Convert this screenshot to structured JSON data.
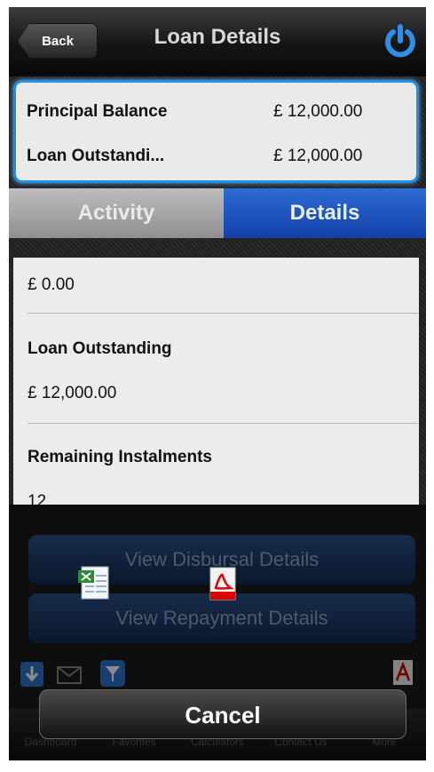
{
  "header": {
    "back_label": "Back",
    "title": "Loan Details",
    "power_icon": "power-icon"
  },
  "summary": {
    "principal_label": "Principal Balance",
    "principal_value": "£ 12,000.00",
    "outstanding_label": "Loan Outstandi...",
    "outstanding_value": "£ 12,000.00"
  },
  "tabs": {
    "activity": "Activity",
    "details": "Details",
    "selected": "Details"
  },
  "details": {
    "top_value": "£ 0.00",
    "loan_outstanding_label": "Loan Outstanding",
    "loan_outstanding_value": "£ 12,000.00",
    "remaining_label": "Remaining Instalments",
    "remaining_value": "12"
  },
  "actions": {
    "disbursal": "View Disbursal Details",
    "repayment": "View Repayment Details"
  },
  "tabbar": {
    "items": [
      {
        "label": "Dashboard",
        "icon": "dashboard-icon"
      },
      {
        "label": "Favorites",
        "icon": "star-icon"
      },
      {
        "label": "Calculators",
        "icon": "calculator-icon"
      },
      {
        "label": "Contact Us",
        "icon": "contact-icon"
      },
      {
        "label": "More",
        "icon": "more-icon"
      }
    ]
  },
  "sheet": {
    "cancel_label": "Cancel",
    "export_options": [
      "excel-icon",
      "pdf-icon"
    ]
  },
  "colors": {
    "accent_blue": "#1241a8",
    "summary_border": "#1f8fe0"
  }
}
